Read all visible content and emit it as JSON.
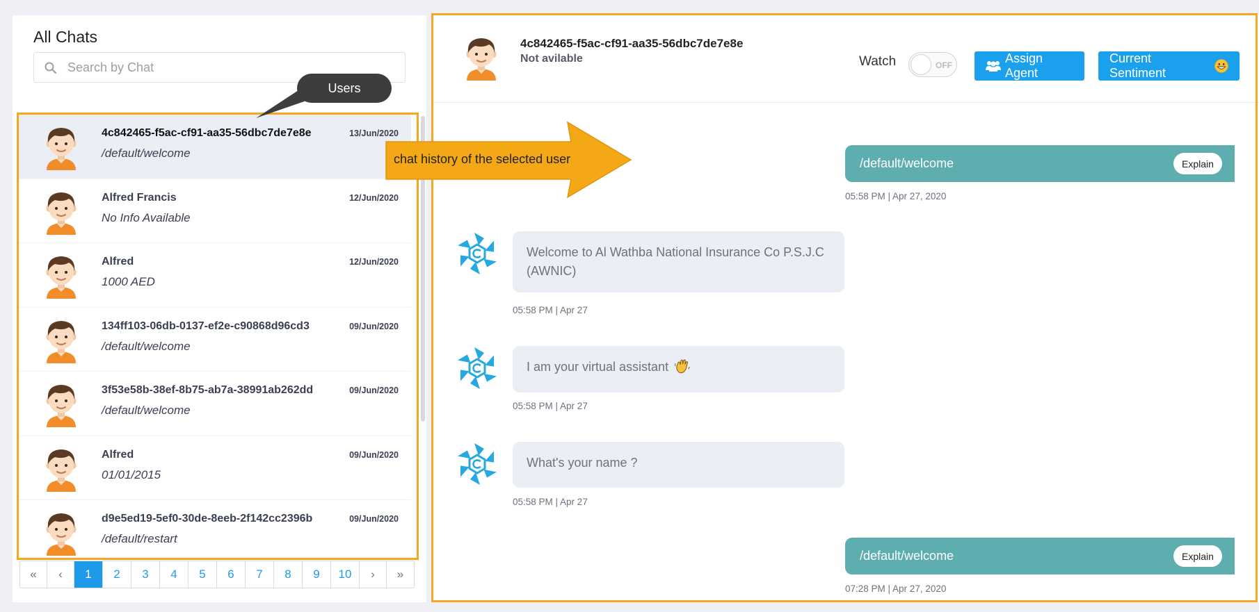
{
  "left_panel": {
    "title": "All Chats",
    "search_placeholder": "Search by Chat",
    "chats": [
      {
        "name": "4c842465-f5ac-cf91-aa35-56dbc7de7e8e",
        "message": "/default/welcome",
        "date": "13/Jun/2020",
        "active": true
      },
      {
        "name": "Alfred Francis",
        "message": "No Info Available",
        "date": "12/Jun/2020",
        "active": false
      },
      {
        "name": "Alfred",
        "message": "1000 AED",
        "date": "12/Jun/2020",
        "active": false
      },
      {
        "name": "134ff103-06db-0137-ef2e-c90868d96cd3",
        "message": "/default/welcome",
        "date": "09/Jun/2020",
        "active": false
      },
      {
        "name": "3f53e58b-38ef-8b75-ab7a-38991ab262dd",
        "message": "/default/welcome",
        "date": "09/Jun/2020",
        "active": false
      },
      {
        "name": "Alfred",
        "message": "01/01/2015",
        "date": "09/Jun/2020",
        "active": false
      },
      {
        "name": "d9e5ed19-5ef0-30de-8eeb-2f142cc2396b",
        "message": "/default/restart",
        "date": "09/Jun/2020",
        "active": false
      }
    ],
    "pagination": {
      "first": "«",
      "prev": "‹",
      "pages": [
        "1",
        "2",
        "3",
        "4",
        "5",
        "6",
        "7",
        "8",
        "9",
        "10"
      ],
      "current": "1",
      "next": "›",
      "last": "»"
    }
  },
  "right_panel": {
    "user_id": "4c842465-f5ac-cf91-aa35-56dbc7de7e8e",
    "status": "Not avilable",
    "watch_label": "Watch",
    "toggle_text": "OFF",
    "assign_agent_label": "Assign Agent",
    "current_sentiment_label": "Current Sentiment",
    "explain_label": "Explain",
    "messages": [
      {
        "from": "user",
        "text": "/default/welcome",
        "time": "05:58 PM | Apr 27, 2020"
      },
      {
        "from": "bot",
        "text": "Welcome to Al Wathba National Insurance Co P.S.J.C (AWNIC)",
        "time": "05:58 PM | Apr 27"
      },
      {
        "from": "bot",
        "text": "I am your virtual assistant",
        "emoji": "waving-hand-icon",
        "time": "05:58 PM | Apr 27"
      },
      {
        "from": "bot",
        "text": "What's your name ?",
        "time": "05:58 PM | Apr 27"
      },
      {
        "from": "user",
        "text": "/default/welcome",
        "time": "07:28 PM | Apr 27, 2020"
      }
    ]
  },
  "annotations": {
    "users_tooltip": "Users",
    "chat_history_callout": "chat history of the selected user"
  },
  "colors": {
    "accent_blue": "#1aa0ed",
    "user_bubble": "#5eaeb0",
    "bot_bubble": "#eceef5",
    "annotation_orange": "#f5a623",
    "active_row": "#eceef5"
  }
}
